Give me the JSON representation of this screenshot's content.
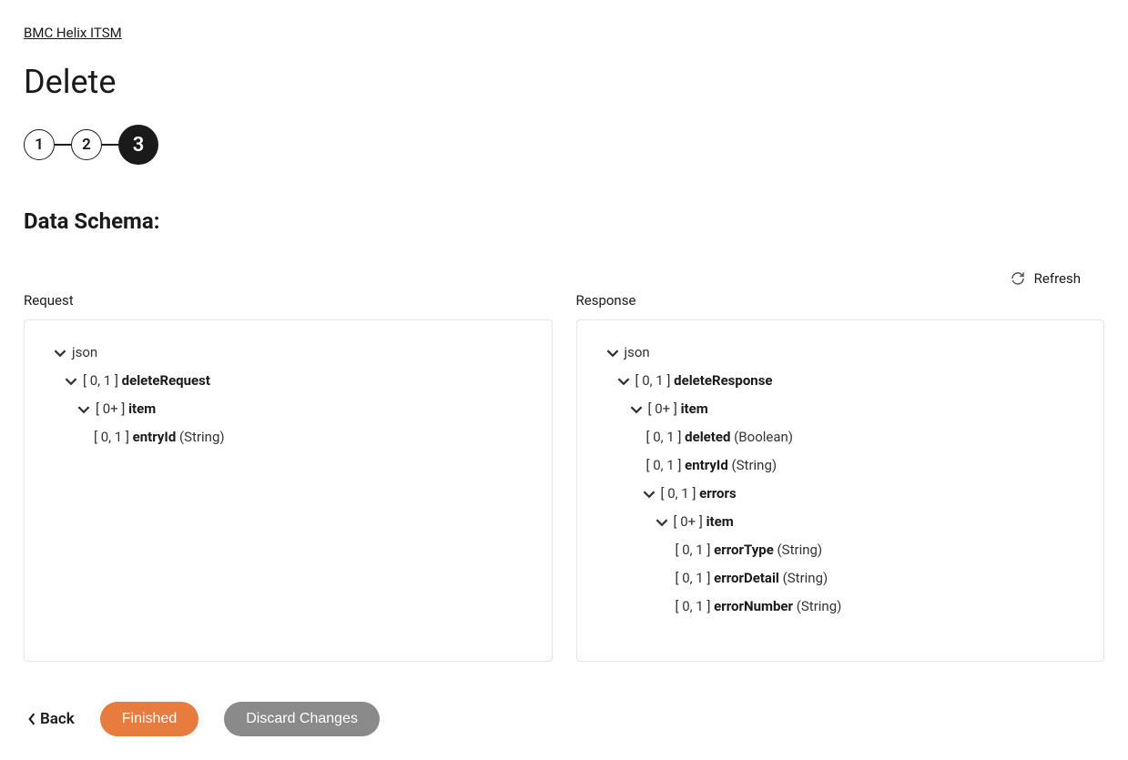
{
  "breadcrumb": "BMC Helix ITSM",
  "page_title": "Delete",
  "stepper": {
    "step1": "1",
    "step2": "2",
    "step3": "3"
  },
  "section_title": "Data Schema:",
  "refresh_label": "Refresh",
  "request": {
    "label": "Request",
    "root": "json",
    "n0": {
      "card": "[ 0, 1 ]",
      "name": "deleteRequest"
    },
    "n1": {
      "card": "[ 0+ ]",
      "name": "item"
    },
    "n2": {
      "card": "[ 0, 1 ]",
      "name": "entryId",
      "type": "(String)"
    }
  },
  "response": {
    "label": "Response",
    "root": "json",
    "n0": {
      "card": "[ 0, 1 ]",
      "name": "deleteResponse"
    },
    "n1": {
      "card": "[ 0+ ]",
      "name": "item"
    },
    "n2": {
      "card": "[ 0, 1 ]",
      "name": "deleted",
      "type": "(Boolean)"
    },
    "n3": {
      "card": "[ 0, 1 ]",
      "name": "entryId",
      "type": "(String)"
    },
    "n4": {
      "card": "[ 0, 1 ]",
      "name": "errors"
    },
    "n5": {
      "card": "[ 0+ ]",
      "name": "item"
    },
    "n6": {
      "card": "[ 0, 1 ]",
      "name": "errorType",
      "type": "(String)"
    },
    "n7": {
      "card": "[ 0, 1 ]",
      "name": "errorDetail",
      "type": "(String)"
    },
    "n8": {
      "card": "[ 0, 1 ]",
      "name": "errorNumber",
      "type": "(String)"
    }
  },
  "footer": {
    "back": "Back",
    "finished": "Finished",
    "discard": "Discard Changes"
  }
}
